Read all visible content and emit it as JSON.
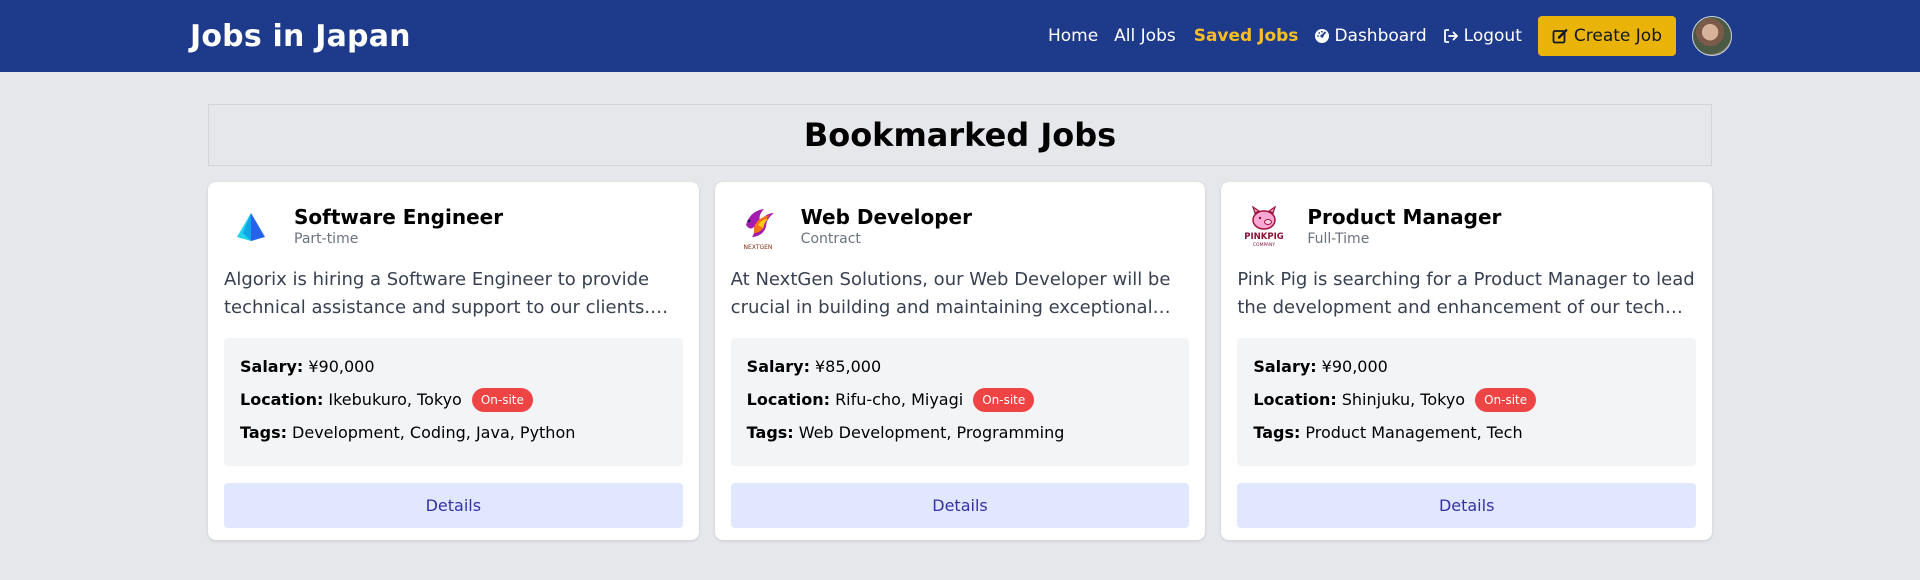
{
  "navbar": {
    "brand": "Jobs in Japan",
    "links": [
      {
        "label": "Home"
      },
      {
        "label": "All Jobs"
      },
      {
        "label": "Saved Jobs"
      },
      {
        "label": "Dashboard",
        "icon": "gauge-icon"
      },
      {
        "label": "Logout",
        "icon": "logout-icon"
      }
    ],
    "create_label": "Create Job",
    "create_icon": "edit-icon"
  },
  "page": {
    "title": "Bookmarked Jobs"
  },
  "labels": {
    "salary": "Salary:",
    "location": "Location:",
    "tags": "Tags:",
    "details": "Details"
  },
  "jobs": [
    {
      "title": "Software Engineer",
      "type": "Part-time",
      "description": "Algorix is hiring a Software Engineer to provide technical assistance and support to our clients. Yo...",
      "salary": "¥90,000",
      "location": "Ikebukuro, Tokyo",
      "badge": "On-site",
      "tags": "Development, Coding, Java, Python",
      "logo": "algorix-logo"
    },
    {
      "title": "Web Developer",
      "type": "Contract",
      "description": "At NextGen Solutions, our Web Developer will be crucial in building and maintaining exceptional web...",
      "salary": "¥85,000",
      "location": "Rifu-cho, Miyagi",
      "badge": "On-site",
      "tags": "Web Development, Programming",
      "logo": "nextgen-logo",
      "logo_text": "NEXTGEN"
    },
    {
      "title": "Product Manager",
      "type": "Full-Time",
      "description": "Pink Pig is searching for a Product Manager to lead the development and enhancement of our tech prod...",
      "salary": "¥90,000",
      "location": "Shinjuku, Tokyo",
      "badge": "On-site",
      "tags": "Product Management, Tech",
      "logo": "pinkpig-logo",
      "logo_text": "PINKPIG",
      "logo_subtext": "COMPANY"
    }
  ],
  "colors": {
    "navbar": "#1e3a8a",
    "active_link": "#fbbf24",
    "create_button": "#eab308",
    "badge": "#ef4444",
    "details_button": "#e0e7ff"
  }
}
